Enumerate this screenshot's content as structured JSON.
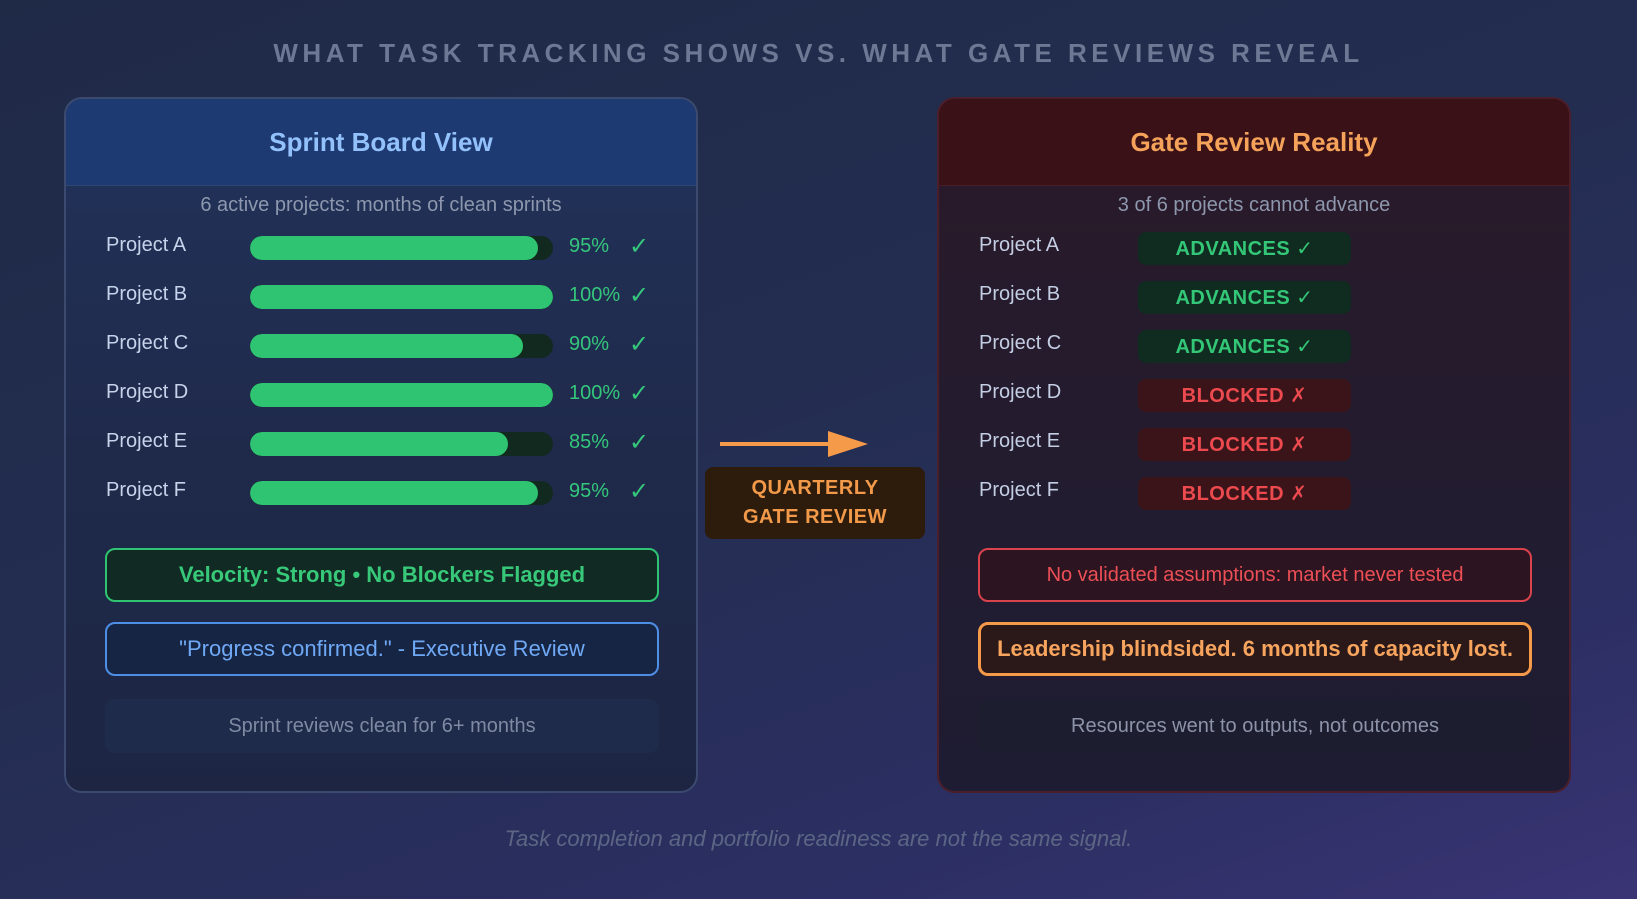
{
  "headline": "WHAT TASK TRACKING SHOWS VS. WHAT GATE REVIEWS REVEAL",
  "colors": {
    "green": "#2ec471",
    "red": "#ec4a4f",
    "orange": "#f59a48",
    "blue": "#4e8fe6"
  },
  "left_panel": {
    "title": "Sprint Board View",
    "subtitle": "6 active projects: months of clean sprints",
    "projects": [
      {
        "name": "Project A",
        "progress": 95,
        "pct_label": "95%",
        "check": "✓"
      },
      {
        "name": "Project B",
        "progress": 100,
        "pct_label": "100%",
        "check": "✓"
      },
      {
        "name": "Project C",
        "progress": 90,
        "pct_label": "90%",
        "check": "✓"
      },
      {
        "name": "Project D",
        "progress": 100,
        "pct_label": "100%",
        "check": "✓"
      },
      {
        "name": "Project E",
        "progress": 85,
        "pct_label": "85%",
        "check": "✓"
      },
      {
        "name": "Project F",
        "progress": 95,
        "pct_label": "95%",
        "check": "✓"
      }
    ],
    "velocity": "Velocity: Strong • No Blockers Flagged",
    "quote": "\"Progress confirmed.\" - Executive Review",
    "note": "Sprint reviews clean for 6+ months"
  },
  "connector": {
    "line1": "QUARTERLY",
    "line2": "GATE REVIEW",
    "icon": "right-arrow-icon"
  },
  "right_panel": {
    "title": "Gate Review Reality",
    "subtitle": "3 of 6 projects cannot advance",
    "projects": [
      {
        "name": "Project A",
        "status": "ADVANCES ✓",
        "state": "ok"
      },
      {
        "name": "Project B",
        "status": "ADVANCES ✓",
        "state": "ok"
      },
      {
        "name": "Project C",
        "status": "ADVANCES ✓",
        "state": "ok"
      },
      {
        "name": "Project D",
        "status": "BLOCKED ✗",
        "state": "bad"
      },
      {
        "name": "Project E",
        "status": "BLOCKED ✗",
        "state": "bad"
      },
      {
        "name": "Project F",
        "status": "BLOCKED ✗",
        "state": "bad"
      }
    ],
    "assumptions": "No validated assumptions: market never tested",
    "leadership": "Leadership blindsided. 6 months of capacity lost.",
    "note": "Resources went to outputs, not outcomes"
  },
  "footer": "Task completion and portfolio readiness are not the same signal."
}
